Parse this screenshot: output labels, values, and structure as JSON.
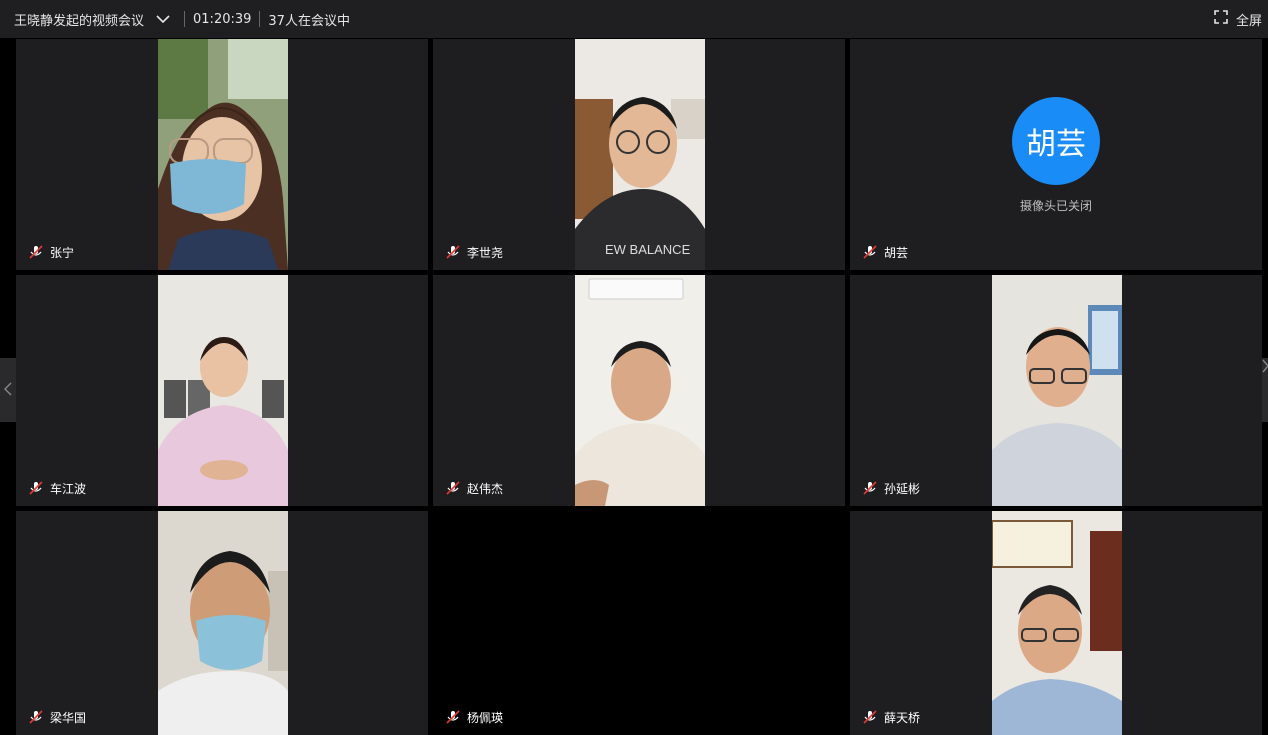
{
  "header": {
    "title": "王晓静发起的视频会议",
    "elapsed": "01:20:39",
    "participants": "37人在会议中",
    "fullscreen_label": "全屏"
  },
  "tiles": [
    {
      "name": "张宁",
      "camera": "on"
    },
    {
      "name": "李世尧",
      "camera": "on"
    },
    {
      "name": "胡芸",
      "camera": "off",
      "avatar_text": "胡芸",
      "status": "摄像头已关闭"
    },
    {
      "name": "车江波",
      "camera": "on"
    },
    {
      "name": "赵伟杰",
      "camera": "on"
    },
    {
      "name": "孙延彬",
      "camera": "on"
    },
    {
      "name": "梁华国",
      "camera": "on"
    },
    {
      "name": "杨佩瑛",
      "camera": "on",
      "video_black": true
    },
    {
      "name": "薛天桥",
      "camera": "on"
    }
  ],
  "colors": {
    "topbar": "#1f1f21",
    "tile_bg": "#1e1e20",
    "avatar": "#1a8cf7"
  },
  "icons": [
    "chevron-down-icon",
    "fullscreen-icon",
    "mic-muted-icon",
    "chevron-left-icon",
    "chevron-right-icon"
  ]
}
